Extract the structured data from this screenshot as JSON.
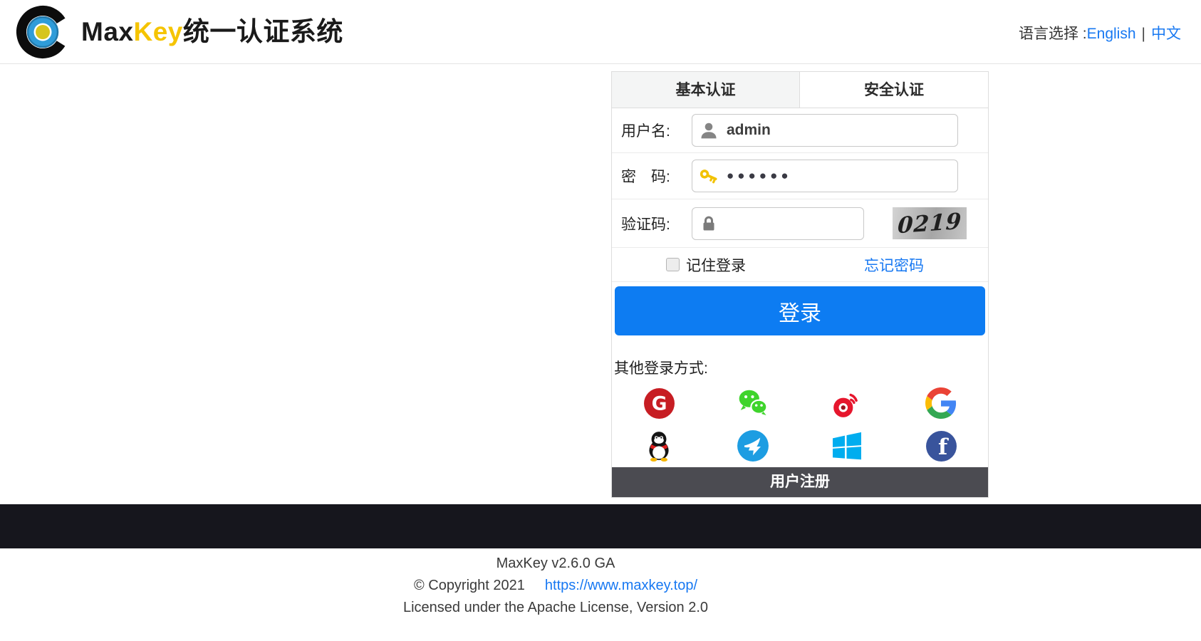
{
  "header": {
    "title_max": "Max",
    "title_key": "Key",
    "title_suffix": "统一认证系统",
    "language_label": "语言选择 :",
    "language_english": "English",
    "language_separator": "|",
    "language_chinese": "中文"
  },
  "login_panel": {
    "tabs": [
      {
        "label": "基本认证",
        "active": true
      },
      {
        "label": "安全认证",
        "active": false
      }
    ],
    "fields": {
      "username": {
        "label": "用户名:",
        "value": "admin",
        "icon": "user-icon"
      },
      "password": {
        "label": "密　码:",
        "value": "●●●●●●",
        "icon": "key-icon"
      },
      "captcha": {
        "label": "验证码:",
        "value": "",
        "icon": "lock-icon",
        "captcha_text": "0219"
      }
    },
    "remember_label": "记住登录",
    "forgot_label": "忘记密码",
    "login_button": "登录",
    "other_login_label": "其他登录方式:",
    "social_icons": [
      {
        "name": "gitee-icon"
      },
      {
        "name": "wechat-icon"
      },
      {
        "name": "weibo-icon"
      },
      {
        "name": "google-icon"
      },
      {
        "name": "qq-icon"
      },
      {
        "name": "dingtalk-icon"
      },
      {
        "name": "windows-icon"
      },
      {
        "name": "facebook-icon"
      }
    ],
    "register_label": "用户注册"
  },
  "footer": {
    "version_line": "MaxKey  v2.6.0 GA",
    "copyright_text": "© Copyright 2021",
    "site_link": "https://www.maxkey.top/",
    "license_line": "Licensed under the Apache License, Version 2.0"
  },
  "colors": {
    "brand_yellow": "#f5c400",
    "link_blue": "#1778f2",
    "button_blue": "#0d7cf2",
    "register_bar": "#4b4b51",
    "footer_band": "#16161d",
    "gitee_red": "#c71d23",
    "wechat_green": "#3fd42c",
    "weibo_red": "#e6162d",
    "dingtalk_blue": "#1d9de2",
    "windows_blue": "#00adef",
    "facebook_blue": "#39549c"
  }
}
